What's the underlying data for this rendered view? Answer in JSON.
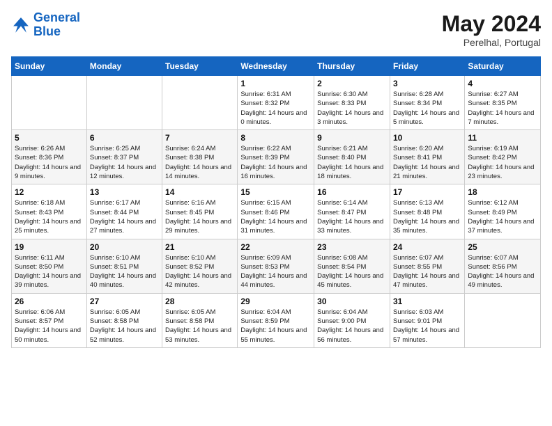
{
  "header": {
    "logo_line1": "General",
    "logo_line2": "Blue",
    "month": "May 2024",
    "location": "Perelhal, Portugal"
  },
  "weekdays": [
    "Sunday",
    "Monday",
    "Tuesday",
    "Wednesday",
    "Thursday",
    "Friday",
    "Saturday"
  ],
  "weeks": [
    [
      {
        "day": "",
        "info": ""
      },
      {
        "day": "",
        "info": ""
      },
      {
        "day": "",
        "info": ""
      },
      {
        "day": "1",
        "sunrise": "6:31 AM",
        "sunset": "8:32 PM",
        "daylight": "14 hours and 0 minutes."
      },
      {
        "day": "2",
        "sunrise": "6:30 AM",
        "sunset": "8:33 PM",
        "daylight": "14 hours and 3 minutes."
      },
      {
        "day": "3",
        "sunrise": "6:28 AM",
        "sunset": "8:34 PM",
        "daylight": "14 hours and 5 minutes."
      },
      {
        "day": "4",
        "sunrise": "6:27 AM",
        "sunset": "8:35 PM",
        "daylight": "14 hours and 7 minutes."
      }
    ],
    [
      {
        "day": "5",
        "sunrise": "6:26 AM",
        "sunset": "8:36 PM",
        "daylight": "14 hours and 9 minutes."
      },
      {
        "day": "6",
        "sunrise": "6:25 AM",
        "sunset": "8:37 PM",
        "daylight": "14 hours and 12 minutes."
      },
      {
        "day": "7",
        "sunrise": "6:24 AM",
        "sunset": "8:38 PM",
        "daylight": "14 hours and 14 minutes."
      },
      {
        "day": "8",
        "sunrise": "6:22 AM",
        "sunset": "8:39 PM",
        "daylight": "14 hours and 16 minutes."
      },
      {
        "day": "9",
        "sunrise": "6:21 AM",
        "sunset": "8:40 PM",
        "daylight": "14 hours and 18 minutes."
      },
      {
        "day": "10",
        "sunrise": "6:20 AM",
        "sunset": "8:41 PM",
        "daylight": "14 hours and 21 minutes."
      },
      {
        "day": "11",
        "sunrise": "6:19 AM",
        "sunset": "8:42 PM",
        "daylight": "14 hours and 23 minutes."
      }
    ],
    [
      {
        "day": "12",
        "sunrise": "6:18 AM",
        "sunset": "8:43 PM",
        "daylight": "14 hours and 25 minutes."
      },
      {
        "day": "13",
        "sunrise": "6:17 AM",
        "sunset": "8:44 PM",
        "daylight": "14 hours and 27 minutes."
      },
      {
        "day": "14",
        "sunrise": "6:16 AM",
        "sunset": "8:45 PM",
        "daylight": "14 hours and 29 minutes."
      },
      {
        "day": "15",
        "sunrise": "6:15 AM",
        "sunset": "8:46 PM",
        "daylight": "14 hours and 31 minutes."
      },
      {
        "day": "16",
        "sunrise": "6:14 AM",
        "sunset": "8:47 PM",
        "daylight": "14 hours and 33 minutes."
      },
      {
        "day": "17",
        "sunrise": "6:13 AM",
        "sunset": "8:48 PM",
        "daylight": "14 hours and 35 minutes."
      },
      {
        "day": "18",
        "sunrise": "6:12 AM",
        "sunset": "8:49 PM",
        "daylight": "14 hours and 37 minutes."
      }
    ],
    [
      {
        "day": "19",
        "sunrise": "6:11 AM",
        "sunset": "8:50 PM",
        "daylight": "14 hours and 39 minutes."
      },
      {
        "day": "20",
        "sunrise": "6:10 AM",
        "sunset": "8:51 PM",
        "daylight": "14 hours and 40 minutes."
      },
      {
        "day": "21",
        "sunrise": "6:10 AM",
        "sunset": "8:52 PM",
        "daylight": "14 hours and 42 minutes."
      },
      {
        "day": "22",
        "sunrise": "6:09 AM",
        "sunset": "8:53 PM",
        "daylight": "14 hours and 44 minutes."
      },
      {
        "day": "23",
        "sunrise": "6:08 AM",
        "sunset": "8:54 PM",
        "daylight": "14 hours and 45 minutes."
      },
      {
        "day": "24",
        "sunrise": "6:07 AM",
        "sunset": "8:55 PM",
        "daylight": "14 hours and 47 minutes."
      },
      {
        "day": "25",
        "sunrise": "6:07 AM",
        "sunset": "8:56 PM",
        "daylight": "14 hours and 49 minutes."
      }
    ],
    [
      {
        "day": "26",
        "sunrise": "6:06 AM",
        "sunset": "8:57 PM",
        "daylight": "14 hours and 50 minutes."
      },
      {
        "day": "27",
        "sunrise": "6:05 AM",
        "sunset": "8:58 PM",
        "daylight": "14 hours and 52 minutes."
      },
      {
        "day": "28",
        "sunrise": "6:05 AM",
        "sunset": "8:58 PM",
        "daylight": "14 hours and 53 minutes."
      },
      {
        "day": "29",
        "sunrise": "6:04 AM",
        "sunset": "8:59 PM",
        "daylight": "14 hours and 55 minutes."
      },
      {
        "day": "30",
        "sunrise": "6:04 AM",
        "sunset": "9:00 PM",
        "daylight": "14 hours and 56 minutes."
      },
      {
        "day": "31",
        "sunrise": "6:03 AM",
        "sunset": "9:01 PM",
        "daylight": "14 hours and 57 minutes."
      },
      {
        "day": "",
        "info": ""
      }
    ]
  ]
}
